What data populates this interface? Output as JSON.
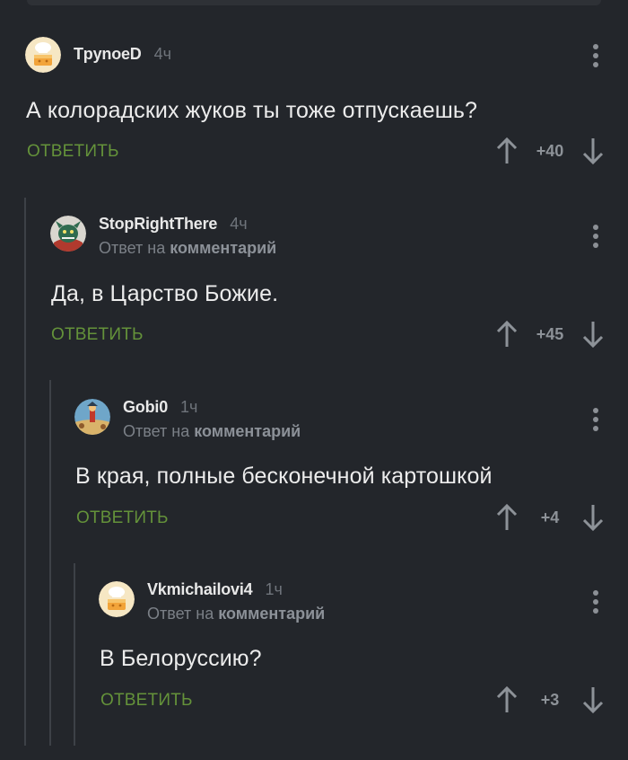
{
  "comments": [
    {
      "author": "TpynoeD",
      "time": "4ч",
      "reply_prefix": "",
      "reply_target": "",
      "text": "А колорадских жуков ты тоже отпускаешь?",
      "reply_label": "ОТВЕТИТЬ",
      "score": "+40",
      "avatar_icon": "chef-cake-avatar"
    },
    {
      "author": "StopRightThere",
      "time": "4ч",
      "reply_prefix": "Ответ на",
      "reply_target": "комментарий",
      "text": "Да, в Царство Божие.",
      "reply_label": "ОТВЕТИТЬ",
      "score": "+45",
      "avatar_icon": "dragon-avatar"
    },
    {
      "author": "Gobi0",
      "time": "1ч",
      "reply_prefix": "Ответ на",
      "reply_target": "комментарий",
      "text": "В края, полные бесконечной картошкой",
      "reply_label": "ОТВЕТИТЬ",
      "score": "+4",
      "avatar_icon": "cartoon-scene-avatar"
    },
    {
      "author": "Vkmichailovi4",
      "time": "1ч",
      "reply_prefix": "Ответ на",
      "reply_target": "комментарий",
      "text": "В Белоруссию?",
      "reply_label": "ОТВЕТИТЬ",
      "score": "+3",
      "avatar_icon": "chef-cake-avatar"
    }
  ],
  "colors": {
    "background": "#23262b",
    "reply_green": "#64923a",
    "thread_line": "#3d4147"
  }
}
